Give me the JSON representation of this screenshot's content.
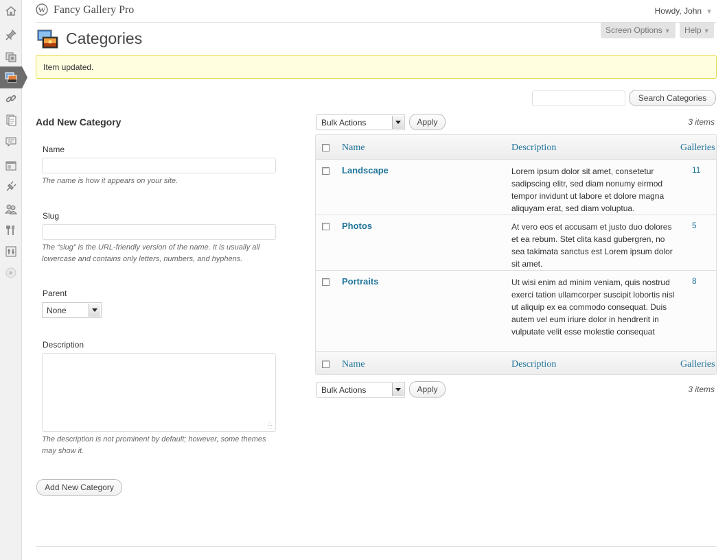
{
  "header": {
    "site_title": "Fancy Gallery Pro",
    "greeting": "Howdy, John"
  },
  "page": {
    "title": "Categories",
    "screen_options": "Screen Options",
    "help": "Help"
  },
  "notice": {
    "message": "Item updated."
  },
  "search": {
    "button": "Search Categories",
    "value": ""
  },
  "form": {
    "heading": "Add New Category",
    "name_label": "Name",
    "name_help": "The name is how it appears on your site.",
    "slug_label": "Slug",
    "slug_help": "The “slug” is the URL-friendly version of the name. It is usually all lowercase and contains only letters, numbers, and hyphens.",
    "parent_label": "Parent",
    "parent_value": "None",
    "description_label": "Description",
    "description_help": "The description is not prominent by default; however, some themes may show it.",
    "submit": "Add New Category"
  },
  "table": {
    "bulk_actions": "Bulk Actions",
    "apply": "Apply",
    "items_count": "3 items",
    "columns": {
      "name": "Name",
      "description": "Description",
      "galleries": "Galleries"
    },
    "rows": [
      {
        "name": "Landscape",
        "description": "Lorem ipsum dolor sit amet, consetetur sadipscing elitr, sed diam nonumy eirmod tempor invidunt ut labore et dolore magna aliquyam erat, sed diam voluptua.",
        "galleries": "11"
      },
      {
        "name": "Photos",
        "description": "At vero eos et accusam et justo duo dolores et ea rebum. Stet clita kasd gubergren, no sea takimata sanctus est Lorem ipsum dolor sit amet.",
        "galleries": "5"
      },
      {
        "name": "Portraits",
        "description": "Ut wisi enim ad minim veniam, quis nostrud exerci tation ullamcorper suscipit lobortis nisl ut aliquip ex ea commodo consequat. Duis autem vel eum iriure dolor in hendrerit in vulputate velit esse molestie consequat",
        "galleries": "8"
      }
    ]
  },
  "sidebar": {
    "items": [
      {
        "icon": "dashboard-icon"
      },
      {
        "icon": "posts-pin-icon"
      },
      {
        "icon": "media-icon"
      },
      {
        "icon": "gallery-icon",
        "active": true
      },
      {
        "icon": "links-icon"
      },
      {
        "icon": "pages-icon"
      },
      {
        "icon": "comments-icon"
      },
      {
        "icon": "appearance-icon"
      },
      {
        "icon": "plugins-icon"
      },
      {
        "icon": "users-icon"
      },
      {
        "icon": "tools-icon"
      },
      {
        "icon": "settings-icon"
      },
      {
        "icon": "collapse-menu-icon"
      }
    ]
  },
  "colors": {
    "link": "#21759b",
    "notice_bg": "#ffffe0",
    "notice_border": "#e6db55",
    "sidebar_bg": "#f1f1f1"
  }
}
